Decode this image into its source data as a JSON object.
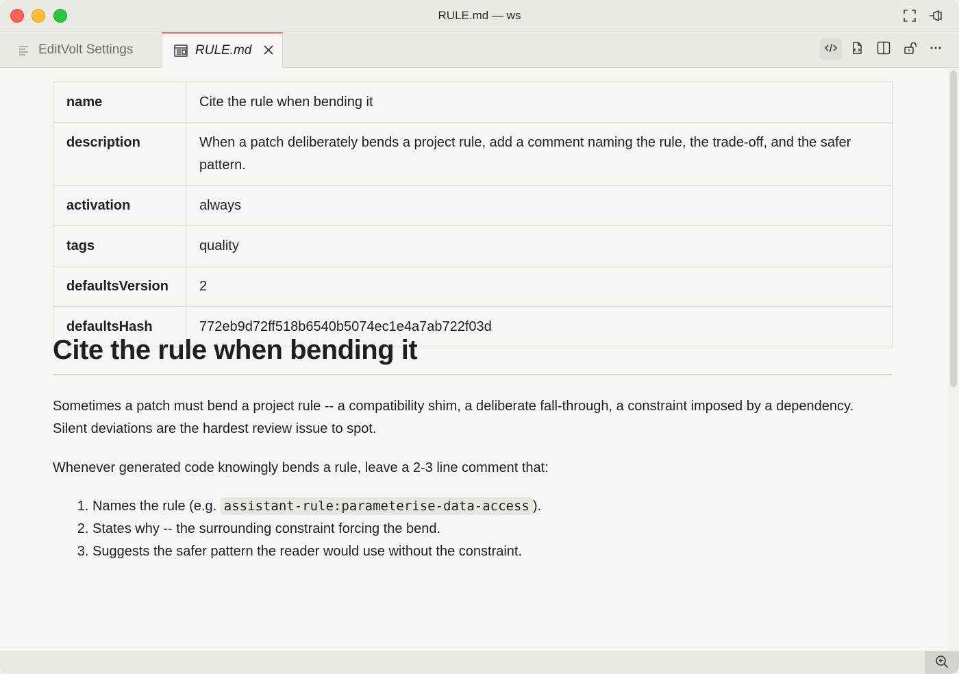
{
  "window": {
    "title": "RULE.md — ws"
  },
  "tabs": [
    {
      "label": "EditVolt Settings",
      "icon": "settings-list-icon",
      "active": false
    },
    {
      "label": "RULE.md",
      "icon": "preview-icon",
      "active": true
    }
  ],
  "toolbar": [
    {
      "icon": "code-icon",
      "active": true
    },
    {
      "icon": "open-changes-icon",
      "active": false
    },
    {
      "icon": "split-editor-icon",
      "active": false
    },
    {
      "icon": "unlock-icon",
      "active": false
    },
    {
      "icon": "more-icon",
      "active": false
    }
  ],
  "frontmatter": [
    {
      "key": "name",
      "value": "Cite the rule when bending it"
    },
    {
      "key": "description",
      "value": "When a patch deliberately bends a project rule, add a comment naming the rule, the trade-off, and the safer pattern."
    },
    {
      "key": "activation",
      "value": "always"
    },
    {
      "key": "tags",
      "value": "quality"
    },
    {
      "key": "defaultsVersion",
      "value": "2"
    },
    {
      "key": "defaultsHash",
      "value": "772eb9d72ff518b6540b5074ec1e4a7ab722f03d"
    }
  ],
  "doc": {
    "heading": "Cite the rule when bending it",
    "para1": "Sometimes a patch must bend a project rule -- a compatibility shim, a deliberate fall-through, a constraint imposed by a dependency. Silent deviations are the hardest review issue to spot.",
    "para2": "Whenever generated code knowingly bends a rule, leave a 2-3 line comment that:",
    "item1_prefix": "Names the rule (e.g. ",
    "item1_code": "assistant-rule:parameterise-data-access",
    "item1_suffix": ").",
    "item2": "States why -- the surrounding constraint forcing the bend.",
    "item3": "Suggests the safer pattern the reader would use without the constraint."
  },
  "colors": {
    "accent_tab": "#e0746a",
    "background": "#f7f6f2"
  }
}
